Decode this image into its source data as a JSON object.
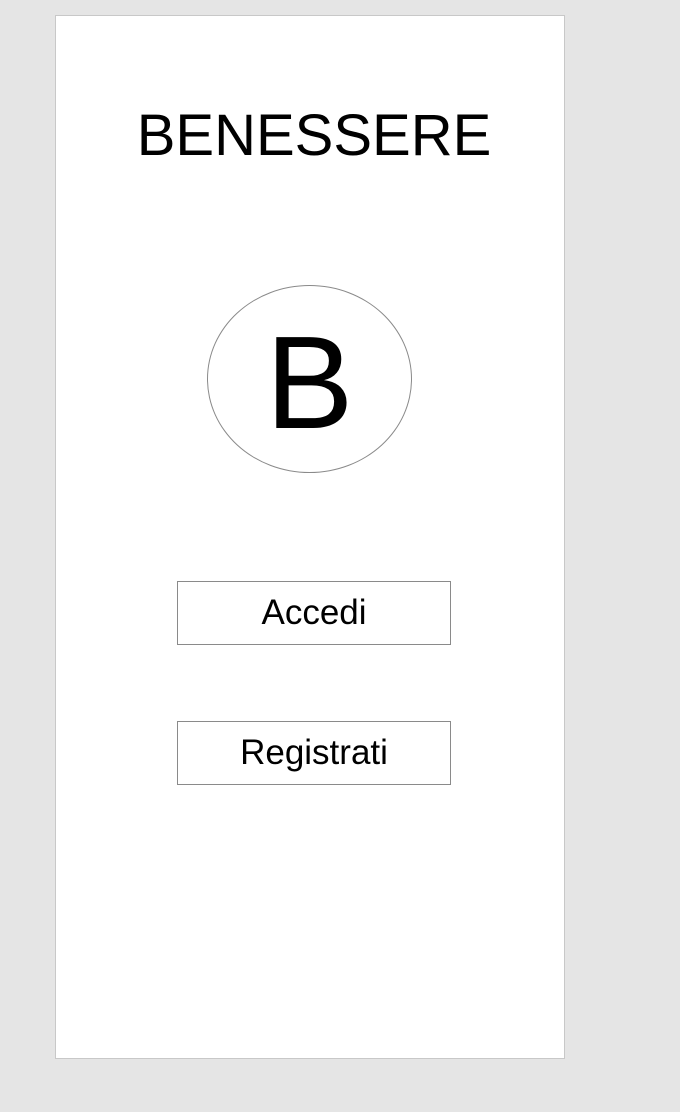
{
  "app": {
    "title": "BENESSERE",
    "logo_letter": "B"
  },
  "actions": {
    "login_label": "Accedi",
    "register_label": "Registrati"
  }
}
